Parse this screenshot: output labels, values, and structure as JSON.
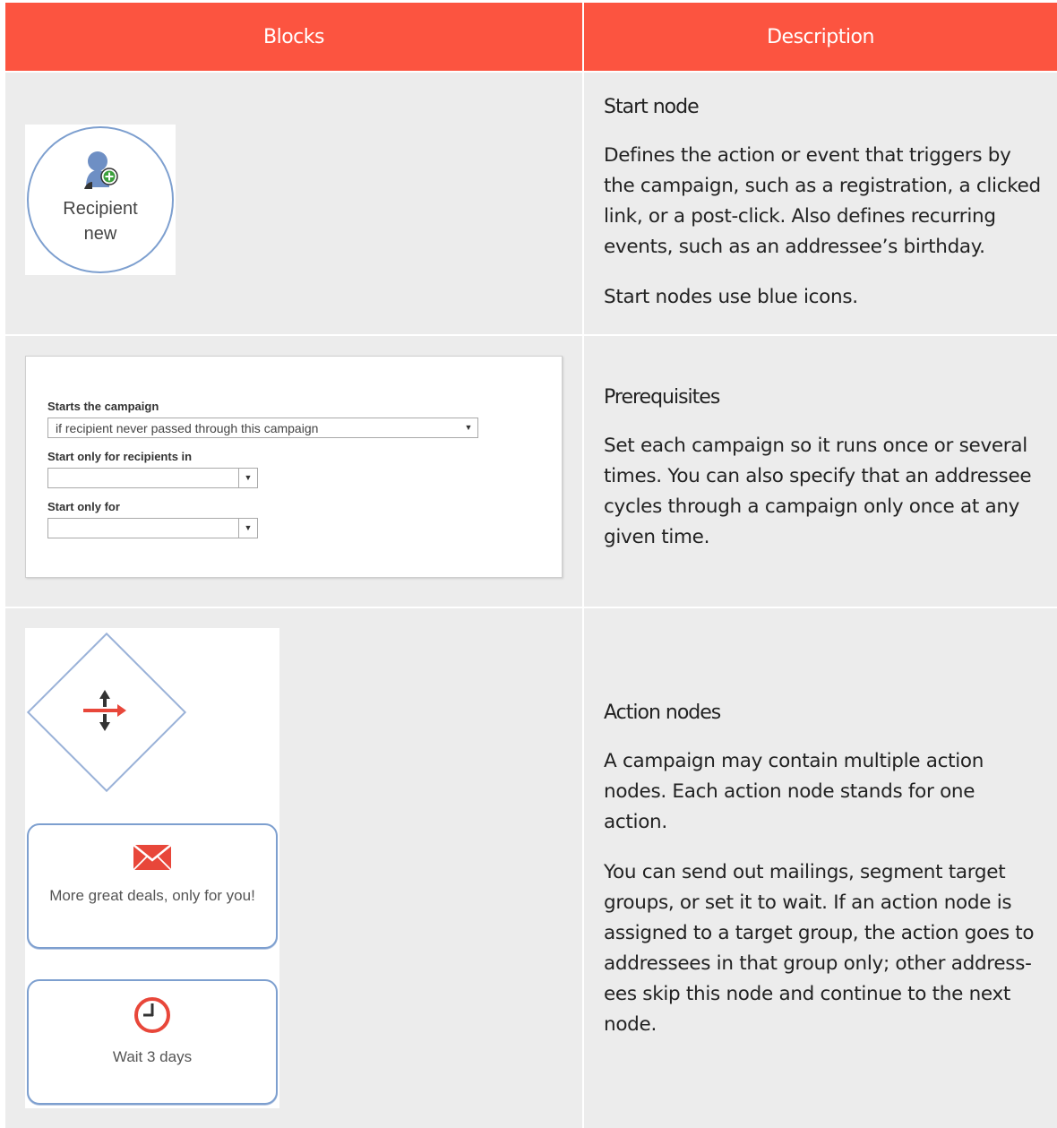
{
  "header": {
    "col1": "Blocks",
    "col2": "Description"
  },
  "rows": [
    {
      "block": {
        "icon": "recipient-new-icon",
        "label_line1": "Recipient",
        "label_line2": "new",
        "border_color": "#7d9fcf"
      },
      "title": "Start node",
      "paragraphs": [
        "Defines the action or event that triggers by the campaign, such as a registration, a clicked link, or a post-click. Also defines recurring events, such as an addressee’s birthday.",
        "Start nodes use blue icons."
      ]
    },
    {
      "block": {
        "label1": "Starts the campaign",
        "select1": "if recipient never passed through this campaign",
        "label2": "Start only for recipients in",
        "select2": "",
        "label3": "Start only for",
        "select3": ""
      },
      "title": "Prerequisites",
      "paragraphs": [
        "Set each campaign so it runs once or several times. You can also specify that an addressee cycles through a campaign only once at any given time."
      ]
    },
    {
      "block": {
        "split_icon": "split-arrows-icon",
        "mail_icon": "envelope-icon",
        "mail_text": "More great deals, only for you!",
        "wait_icon": "clock-icon",
        "wait_text": "Wait 3 days"
      },
      "title": "Action nodes",
      "paragraphs": [
        "A campaign may contain multiple action nodes. Each action node stands for one action.",
        "You can send out mailings, segment target groups, or set it to wait. If an action node is assigned to a target group, the action goes to addressees in that group only; other address-ees skip this node and continue to the next node."
      ]
    }
  ],
  "colors": {
    "header_bg": "#fc5440",
    "cell_bg": "#ececec",
    "accent_red": "#e8473a",
    "node_blue": "#6e8fc4"
  }
}
